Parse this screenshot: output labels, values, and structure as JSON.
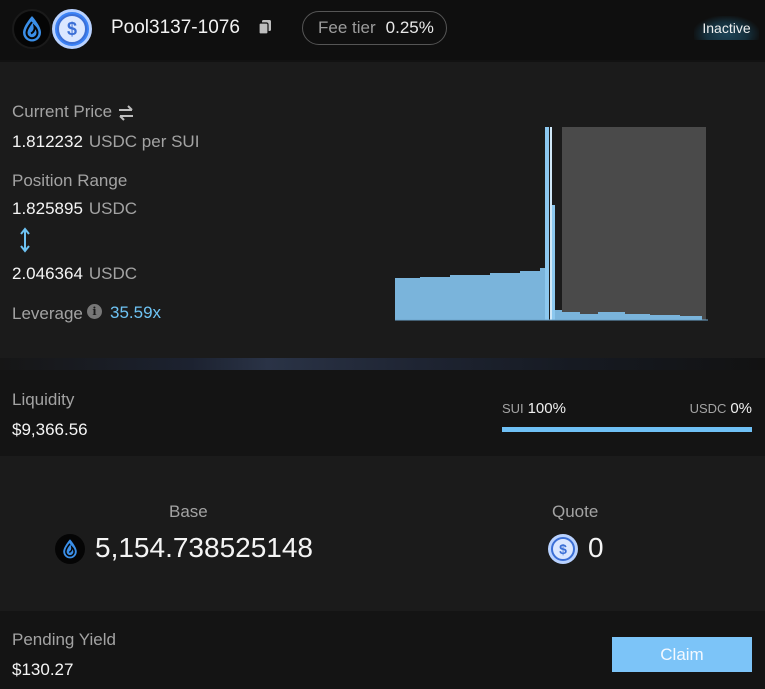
{
  "header": {
    "pool_name": "Pool3137-1076",
    "fee_tier_label": "Fee tier",
    "fee_tier_value": "0.25%",
    "status": "Inactive",
    "base_token_icon": "sui-icon",
    "quote_token_icon": "usdc-icon"
  },
  "price": {
    "current_price_label": "Current Price",
    "current_price_value": "1.812232",
    "current_price_unit": "USDC per SUI",
    "position_range_label": "Position Range",
    "range_low": "1.825895",
    "range_low_unit": "USDC",
    "range_high": "2.046364",
    "range_high_unit": "USDC",
    "leverage_label": "Leverage",
    "leverage_value": "35.59x"
  },
  "liquidity": {
    "label": "Liquidity",
    "value": "$9,366.56",
    "base_symbol": "SUI",
    "base_pct": "100%",
    "quote_symbol": "USDC",
    "quote_pct": "0%",
    "base_fraction": 1.0
  },
  "amounts": {
    "base_label": "Base",
    "base_value": "5,154.738525148",
    "quote_label": "Quote",
    "quote_value": "0"
  },
  "yield": {
    "label": "Pending Yield",
    "value": "$130.27",
    "claim_label": "Claim"
  },
  "colors": {
    "accent": "#6ec3f4",
    "liquidity_bar": "#7ab4db",
    "range_shade": "#4a4a4a",
    "claim_button": "#7cc4f8"
  }
}
